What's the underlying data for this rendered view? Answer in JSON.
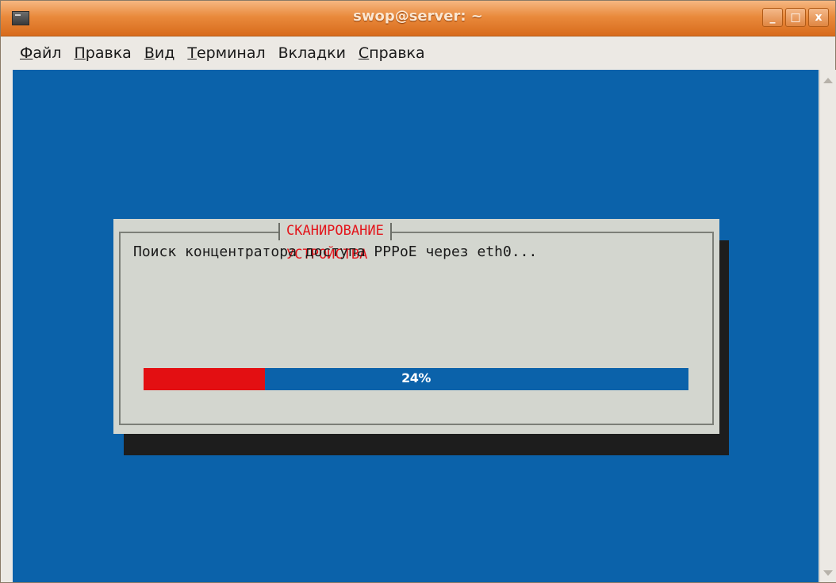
{
  "window": {
    "title": "swop@server: ~",
    "icon": "terminal-icon",
    "controls": {
      "minimize": "_",
      "maximize": "□",
      "close": "x"
    }
  },
  "menubar": [
    {
      "accel": "Ф",
      "rest": "айл"
    },
    {
      "accel": "П",
      "rest": "равка"
    },
    {
      "accel": "В",
      "rest": "ид"
    },
    {
      "accel": "Т",
      "rest": "ерминал"
    },
    {
      "pre": "Вкла",
      "accel": "д",
      "rest": "ки"
    },
    {
      "accel": "С",
      "rest": "правка"
    }
  ],
  "dialog": {
    "title": "СКАНИРОВАНИЕ УСТРОЙСТВА",
    "message": "Поиск концентратора доступа PPPoE через eth0...",
    "progress_percent": 24,
    "progress_label": "24%"
  },
  "colors": {
    "terminal_bg": "#0b62aa",
    "dialog_bg": "#d3d6cf",
    "title_red": "#e3161c",
    "progress_fill": "#e30f12",
    "titlebar_orange": "#e98a3c"
  }
}
